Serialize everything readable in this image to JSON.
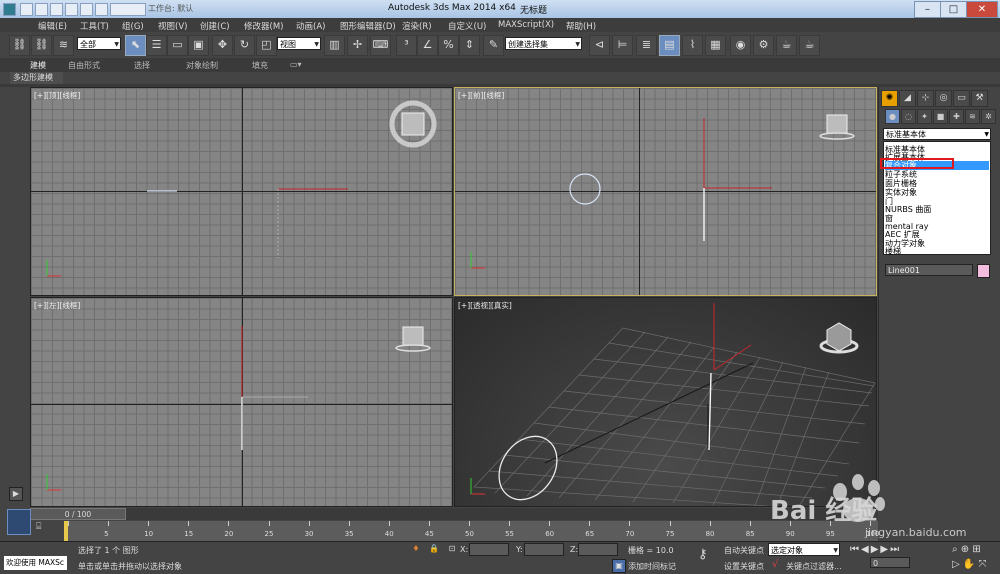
{
  "window": {
    "title": "Autodesk 3ds Max  2014 x64",
    "doc_title": "无标题",
    "workspace_label": "工作台: 默认"
  },
  "menubar": {
    "items": [
      "编辑(E)",
      "工具(T)",
      "组(G)",
      "视图(V)",
      "创建(C)",
      "修改器(M)",
      "动画(A)",
      "图形编辑器(D)",
      "渲染(R)",
      "自定义(U)",
      "MAXScript(X)",
      "帮助(H)"
    ]
  },
  "toolbar": {
    "selection_filter": "全部",
    "ref_coord": "视图",
    "named_selection": "创建选择集"
  },
  "ribbon": {
    "tabs": [
      "建模",
      "自由形式",
      "选择",
      "对象绘制",
      "填充"
    ],
    "subtab": "多边形建模"
  },
  "viewports": {
    "top": "[+][顶][线框]",
    "front": "[+][前][线框]",
    "left": "[+][左][线框]",
    "perspective": "[+][透视][真实]",
    "viewcube_top": "上",
    "viewcube_left": "左"
  },
  "command_panel": {
    "category": "标准基本体",
    "category_options": [
      "标准基本体",
      "扩展基本体",
      "复合对象",
      "粒子系统",
      "面片栅格",
      "实体对象",
      "门",
      "NURBS 曲面",
      "窗",
      "mental ray",
      "AEC 扩展",
      "动力学对象",
      "楼梯"
    ],
    "selected_option": "复合对象",
    "object_name": "Line001"
  },
  "timeline": {
    "frame_display": "0 / 100",
    "ticks": [
      "0",
      "5",
      "10",
      "15",
      "20",
      "25",
      "30",
      "35",
      "40",
      "45",
      "50",
      "55",
      "60",
      "65",
      "70",
      "75",
      "80",
      "85",
      "90",
      "95",
      "100"
    ]
  },
  "status": {
    "maxscript_label": "欢迎使用 MAXSc",
    "selection_info": "选择了 1 个 图形",
    "prompt": "单击或单击并拖动以选择对象",
    "x_label": "X:",
    "y_label": "Y:",
    "z_label": "Z:",
    "grid": "栅格 = 10.0",
    "add_time_tag": "添加时间标记",
    "auto_key": "自动关键点",
    "selected_object": "选定对象",
    "set_key": "设置关键点",
    "key_filters": "关键点过滤器...",
    "frame_field": "0"
  },
  "watermark": {
    "text": "Bai 经验",
    "url": "jingyan.baidu.com"
  },
  "colors": {
    "active_viewport_border": "#c6b15c",
    "highlight": "#3399ff",
    "callout": "#e0191c"
  }
}
